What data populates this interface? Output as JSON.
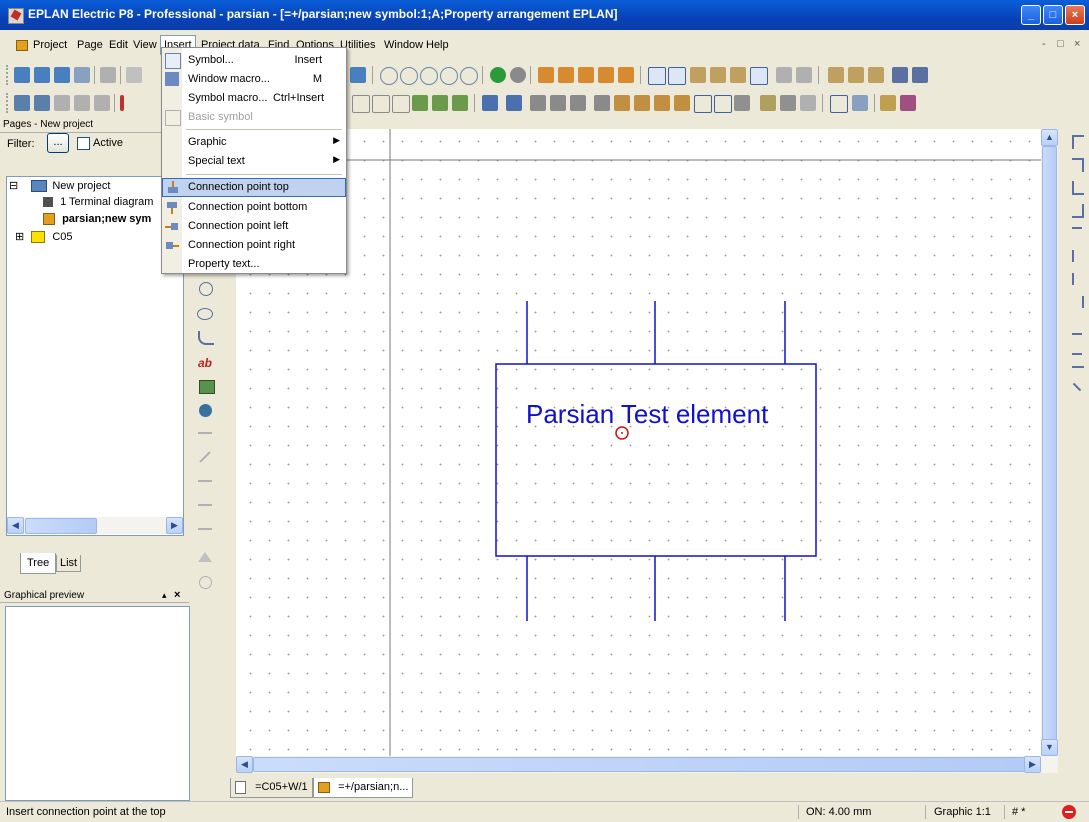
{
  "window": {
    "title": "EPLAN Electric P8 - Professional - parsian - [=+/parsian;new symbol:1;A;Property arrangement EPLAN]",
    "minimize_label": "_",
    "maximize_label": "□",
    "close_label": "×"
  },
  "menubar": {
    "items": [
      "Project",
      "Page",
      "Edit",
      "View",
      "Insert",
      "Project data",
      "Find",
      "Options",
      "Utilities",
      "Window",
      "Help"
    ],
    "open_menu": "Insert",
    "mdi_minimize": "-",
    "mdi_restore": "□",
    "mdi_close": "×"
  },
  "insert_menu": {
    "items": [
      {
        "label": "Symbol...",
        "shortcut": "Insert",
        "icon": "symbol-icon",
        "enabled": true
      },
      {
        "label": "Window macro...",
        "shortcut": "M",
        "icon": "window-macro-icon",
        "enabled": true
      },
      {
        "label": "Symbol macro...",
        "shortcut": "Ctrl+Insert",
        "icon": "",
        "enabled": true
      },
      {
        "label": "Basic symbol",
        "shortcut": "",
        "icon": "basic-symbol-icon",
        "enabled": false
      },
      {
        "label": "Graphic",
        "shortcut": "",
        "submenu": true,
        "enabled": true
      },
      {
        "label": "Special text",
        "shortcut": "",
        "submenu": true,
        "enabled": true
      },
      {
        "label": "Connection point top",
        "shortcut": "",
        "icon": "connection-point-top-icon",
        "highlighted": true,
        "enabled": true
      },
      {
        "label": "Connection point bottom",
        "shortcut": "",
        "icon": "connection-point-bottom-icon",
        "enabled": true
      },
      {
        "label": "Connection point left",
        "shortcut": "",
        "icon": "connection-point-left-icon",
        "enabled": true
      },
      {
        "label": "Connection point right",
        "shortcut": "",
        "icon": "connection-point-right-icon",
        "enabled": true
      },
      {
        "label": "Property text...",
        "shortcut": "",
        "enabled": true
      }
    ],
    "submenu_arrow": "▶"
  },
  "pages_panel": {
    "title": "Pages - New project",
    "filter_label": "Filter:",
    "filter_button": "...",
    "active_label": "Active",
    "active_checked": false,
    "tree": [
      {
        "label": "New project",
        "expander": "⊟",
        "icon": "project-icon"
      },
      {
        "label": "1 Terminal diagram",
        "icon": "terminal-diagram-icon"
      },
      {
        "label": "parsian;new sym",
        "icon": "symbol-page-icon",
        "bold": true
      },
      {
        "label": "C05",
        "expander": "⊞",
        "icon": "folder-icon"
      }
    ],
    "tabs": [
      "Tree",
      "List"
    ]
  },
  "preview_panel": {
    "title": "Graphical preview",
    "pin_label": "▴",
    "close_label": "×"
  },
  "drawing": {
    "symbol_text": "Parsian Test element",
    "line_color": "#1010d0",
    "origin_marker_color": "#d01010"
  },
  "doc_tabs": [
    {
      "label": "=C05+W/1",
      "icon": "page-icon"
    },
    {
      "label": "=+/parsian;n...",
      "icon": "symbol-page-icon"
    }
  ],
  "statusbar": {
    "message": "Insert connection point at the top",
    "grid": "ON: 4.00 mm",
    "scale": "Graphic 1:1",
    "hash": "# *"
  },
  "colors": {
    "titlebar": "#0842b8",
    "menu_highlight": "#c1d2ee",
    "chrome": "#ece9d8"
  }
}
